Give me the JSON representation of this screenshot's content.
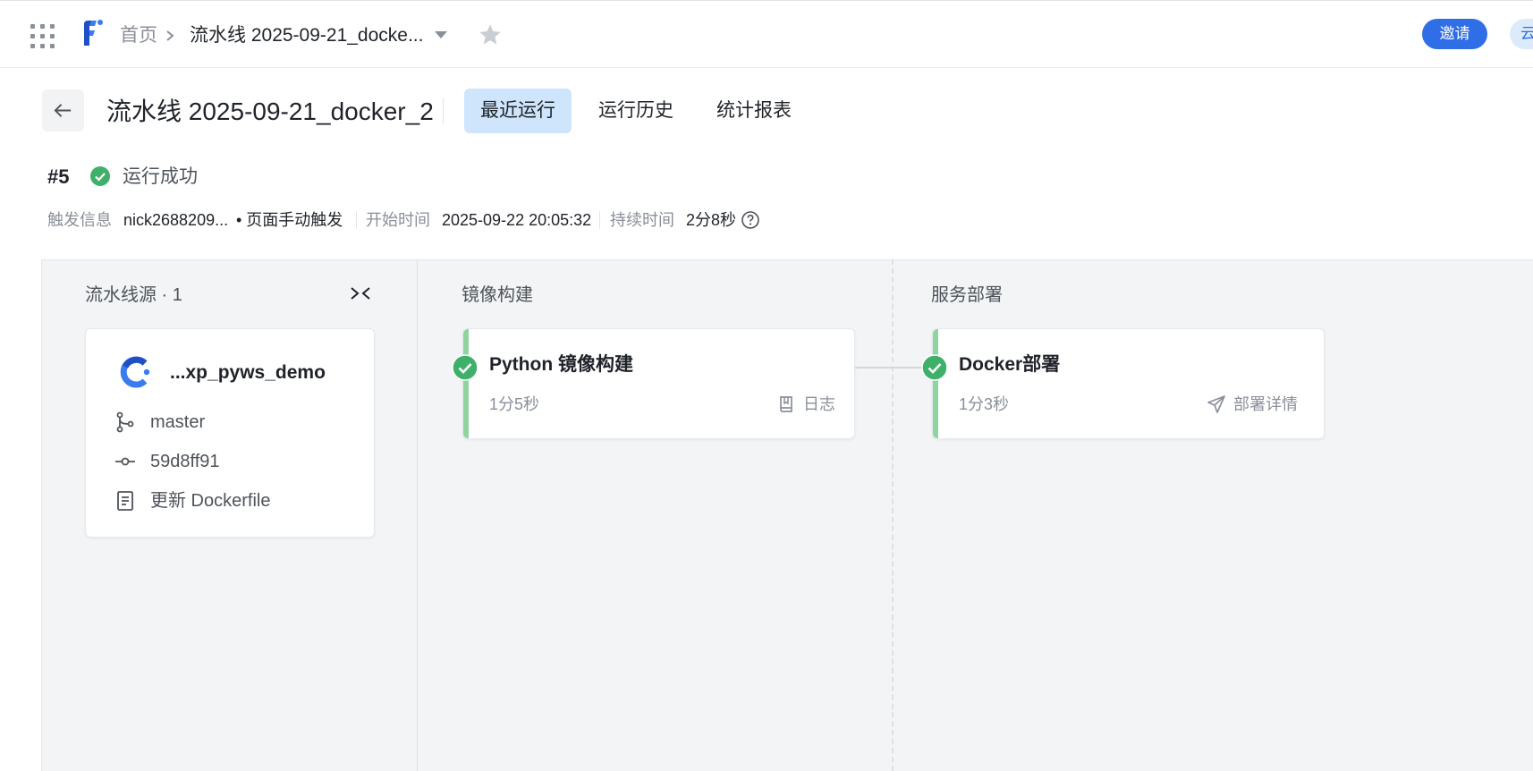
{
  "topbar": {
    "home": "首页",
    "current": "流水线 2025-09-21_docke...",
    "invite_label": "邀请",
    "cloud_label": "云"
  },
  "header": {
    "title": "流水线 2025-09-21_docker_2",
    "tabs": [
      {
        "label": "最近运行",
        "active": true
      },
      {
        "label": "运行历史",
        "active": false
      },
      {
        "label": "统计报表",
        "active": false
      }
    ]
  },
  "run": {
    "number": "#5",
    "status": "运行成功",
    "trigger_label": "触发信息",
    "trigger_user": "nick2688209...",
    "trigger_type": "• 页面手动触发",
    "start_label": "开始时间",
    "start_value": "2025-09-22 20:05:32",
    "duration_label": "持续时间",
    "duration_value": "2分8秒"
  },
  "stages": {
    "source_title": "流水线源 · 1",
    "build_title": "镜像构建",
    "deploy_title": "服务部署"
  },
  "source": {
    "repo": "...xp_pyws_demo",
    "branch": "master",
    "commit": "59d8ff91",
    "message": "更新 Dockerfile"
  },
  "jobs": [
    {
      "name": "Python 镜像构建",
      "time": "1分5秒",
      "action": "日志",
      "status": "success"
    },
    {
      "name": "Docker部署",
      "time": "1分3秒",
      "action": "部署详情",
      "status": "success"
    }
  ],
  "colors": {
    "accent": "#2f6ee6",
    "success": "#3fb06a",
    "active_tab_bg": "#cfe5fb",
    "job_bar": "#8fd4a0"
  },
  "icons": [
    "apps-grid-icon",
    "logo-icon",
    "chevron-right-icon",
    "caret-down-icon",
    "star-icon",
    "back-arrow-icon",
    "check-circle-icon",
    "help-circle-icon",
    "collapse-icon",
    "repo-logo-icon",
    "branch-icon",
    "commit-icon",
    "document-icon",
    "book-icon",
    "send-icon"
  ]
}
